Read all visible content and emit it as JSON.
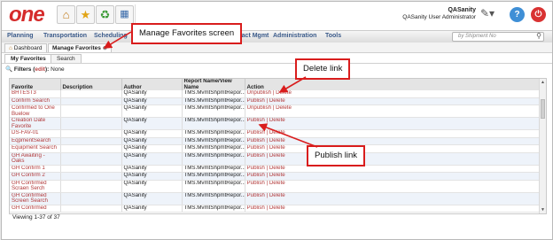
{
  "app": {
    "logo": "one",
    "user_name": "QASanity",
    "user_role": "QASanity User Administrator",
    "help_glyph": "?",
    "power_glyph": "⏻",
    "icons": [
      "home-icon",
      "star-icon",
      "recycle-icon",
      "presentation-icon"
    ]
  },
  "menu": {
    "items": [
      "Planning",
      "Transportation",
      "Scheduling",
      "",
      "",
      "Contract Mgmt",
      "Administration",
      "Tools"
    ],
    "search_placeholder": "by Shipment No"
  },
  "tabs": [
    "Dashboard",
    "Manage Favorites"
  ],
  "subtabs": [
    "My Favorites",
    "Search"
  ],
  "filters": {
    "label": "Filters",
    "edit": "edit",
    "value": "None"
  },
  "table": {
    "headers": [
      "Favorite",
      "Description",
      "Author",
      "Report Name/View Name",
      "Action"
    ],
    "rows": [
      {
        "favorite": "BHTEST3",
        "description": "",
        "author": "QASanity",
        "report": "TMS.MvmtShpmtRepor...",
        "action": "Unpublish | Delete"
      },
      {
        "favorite": "Confirm Search",
        "description": "",
        "author": "QASanity",
        "report": "TMS.MvmtShpmtRepor...",
        "action": "Publish | Delete"
      },
      {
        "favorite": "Confirmed to One Buelow",
        "description": "",
        "author": "QASanity",
        "report": "TMS.MvmtShpmtRepor...",
        "action": "Unpublish | Delete"
      },
      {
        "favorite": "Creation Date Favorite",
        "description": "",
        "author": "QASanity",
        "report": "TMS.MvmtShpmtRepor...",
        "action": "Publish | Delete"
      },
      {
        "favorite": "DS-FAV-01",
        "description": "",
        "author": "QASanity",
        "report": "TMS.MvmtShpmtRepor...",
        "action": "Publish | Delete"
      },
      {
        "favorite": "EqpmentSearch",
        "description": "",
        "author": "QASanity",
        "report": "TMS.MvmtShpmtRepor...",
        "action": "Publish | Delete"
      },
      {
        "favorite": "Equipment Search",
        "description": "",
        "author": "QASanity",
        "report": "TMS.MvmtShpmtRepor...",
        "action": "Publish | Delete"
      },
      {
        "favorite": "GH Awaiting - Oaks",
        "description": "",
        "author": "QASanity",
        "report": "TMS.MvmtShpmtRepor...",
        "action": "Publish | Delete"
      },
      {
        "favorite": "GH Confirm 1",
        "description": "",
        "author": "QASanity",
        "report": "TMS.MvmtShpmtRepor...",
        "action": "Publish | Delete"
      },
      {
        "favorite": "GH Confirm 2",
        "description": "",
        "author": "QASanity",
        "report": "TMS.MvmtShpmtRepor...",
        "action": "Publish | Delete"
      },
      {
        "favorite": "GH Confirmed Scraen Serch",
        "description": "",
        "author": "QASanity",
        "report": "TMS.MvmtShpmtRepor...",
        "action": "Publish | Delete"
      },
      {
        "favorite": "GH Confirmed Screen Search",
        "description": "",
        "author": "QASanity",
        "report": "TMS.MvmtShpmtRepor...",
        "action": "Publish | Delete"
      },
      {
        "favorite": "GH Confirmed",
        "description": "",
        "author": "QASanity",
        "report": "TMS.MvmtShpmtRepor...",
        "action": "Publish | Delete"
      }
    ]
  },
  "viewing": "Viewing 1-37 of 37",
  "callouts": {
    "manage_favorites": "Manage Favorites screen",
    "delete_link": "Delete link",
    "publish_link": "Publish link"
  },
  "colors": {
    "callout_border": "#d91d1d",
    "link": "#b23a3a",
    "logo": "#d52b2b"
  }
}
